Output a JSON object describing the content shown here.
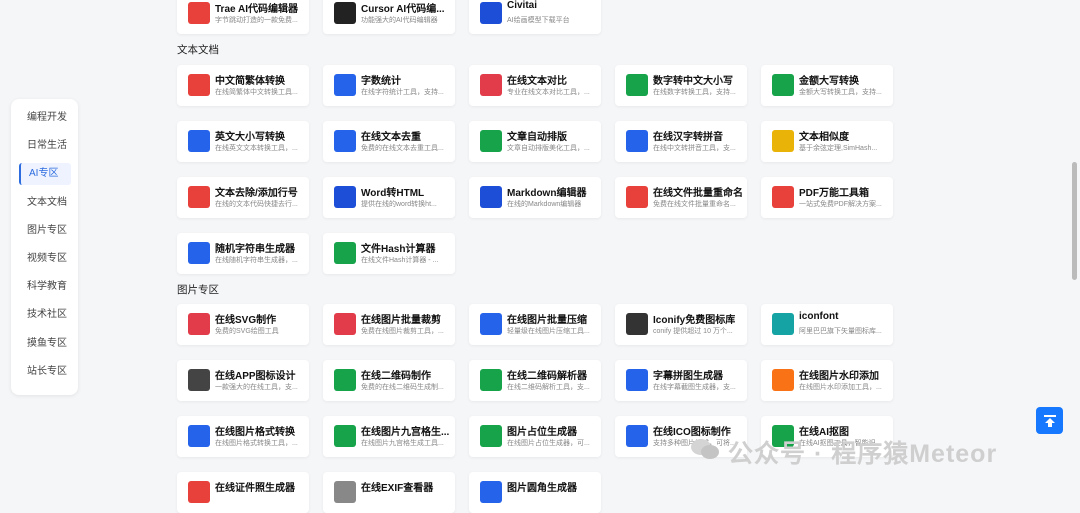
{
  "sidebar": {
    "items": [
      {
        "label": "编程开发",
        "active": false
      },
      {
        "label": "日常生活",
        "active": false
      },
      {
        "label": "AI专区",
        "active": true
      },
      {
        "label": "文本文档",
        "active": false
      },
      {
        "label": "图片专区",
        "active": false
      },
      {
        "label": "视频专区",
        "active": false
      },
      {
        "label": "科学教育",
        "active": false
      },
      {
        "label": "技术社区",
        "active": false
      },
      {
        "label": "摸鱼专区",
        "active": false
      },
      {
        "label": "站长专区",
        "active": false
      }
    ]
  },
  "ai_tools": [
    {
      "title": "Trae AI代码编辑器",
      "desc": "字节跳动打造的一款免费...",
      "icon": "trae-icon",
      "color": "#e8413c"
    },
    {
      "title": "Cursor AI代码编...",
      "desc": "功能强大的AI代码编辑器",
      "icon": "cursor-icon",
      "color": "#222222"
    },
    {
      "title": "Civitai",
      "desc": "AI绘画模型下载平台",
      "icon": "civitai-icon",
      "color": "#1d4ed8"
    }
  ],
  "text_section": {
    "title": "文本文档",
    "tools": [
      {
        "title": "中文简繁体转换",
        "desc": "在线简繁体中文转换工具...",
        "icon": "convert-icon",
        "color": "#e8413c"
      },
      {
        "title": "字数统计",
        "desc": "在线字符统计工具，支持...",
        "icon": "text-count-icon",
        "color": "#2563eb"
      },
      {
        "title": "在线文本对比",
        "desc": "专业在线文本对比工具，...",
        "icon": "compare-icon",
        "color": "#e23b4a"
      },
      {
        "title": "数字转中文大小写",
        "desc": "在线数字转换工具，支持...",
        "icon": "number-icon",
        "color": "#16a34a"
      },
      {
        "title": "金额大写转换",
        "desc": "金额大写转换工具，支持...",
        "icon": "money-icon",
        "color": "#16a34a"
      },
      {
        "title": "英文大小写转换",
        "desc": "在线英文文本转换工具，...",
        "icon": "case-icon",
        "color": "#2563eb"
      },
      {
        "title": "在线文本去重",
        "desc": "免费的在线文本去重工具...",
        "icon": "dedupe-icon",
        "color": "#2563eb"
      },
      {
        "title": "文章自动排版",
        "desc": "文章自动排版美化工具，...",
        "icon": "format-icon",
        "color": "#16a34a"
      },
      {
        "title": "在线汉字转拼音",
        "desc": "在线中文转拼音工具，支...",
        "icon": "pinyin-icon",
        "color": "#2563eb"
      },
      {
        "title": "文本相似度",
        "desc": "基于余弦定理,SimHash...",
        "icon": "similarity-icon",
        "color": "#eab308"
      },
      {
        "title": "文本去除/添加行号",
        "desc": "在线的文本代码快捷去行...",
        "icon": "line-number-icon",
        "color": "#e8413c"
      },
      {
        "title": "Word转HTML",
        "desc": "提供在线的word转换ht...",
        "icon": "word-icon",
        "color": "#1d4ed8"
      },
      {
        "title": "Markdown编辑器",
        "desc": "在线的Markdown编辑器",
        "icon": "markdown-icon",
        "color": "#1d4ed8"
      },
      {
        "title": "在线文件批量重命名",
        "desc": "免费在线文件批量重命名...",
        "icon": "rename-icon",
        "color": "#e8413c"
      },
      {
        "title": "PDF万能工具箱",
        "desc": "一站式免费PDF解决方案...",
        "icon": "pdf-icon",
        "color": "#e8413c"
      },
      {
        "title": "随机字符串生成器",
        "desc": "在线随机字符串生成器，...",
        "icon": "random-string-icon",
        "color": "#2563eb"
      },
      {
        "title": "文件Hash计算器",
        "desc": "在线文件Hash计算器 - ...",
        "icon": "hash-icon",
        "color": "#16a34a"
      }
    ]
  },
  "image_section": {
    "title": "图片专区",
    "tools": [
      {
        "title": "在线SVG制作",
        "desc": "免费的SVG绘图工具",
        "icon": "svg-icon",
        "color": "#e23b4a"
      },
      {
        "title": "在线图片批量裁剪",
        "desc": "免费在线图片裁剪工具，...",
        "icon": "crop-icon",
        "color": "#e23b4a"
      },
      {
        "title": "在线图片批量压缩",
        "desc": "轻量级在线图片压缩工具...",
        "icon": "compress-icon",
        "color": "#2563eb"
      },
      {
        "title": "Iconify免费图标库",
        "desc": "conify 提供超过 10 万个...",
        "icon": "iconify-icon",
        "color": "#333333"
      },
      {
        "title": "iconfont",
        "desc": "阿里巴巴旗下矢量图标库...",
        "icon": "iconfont-icon",
        "color": "#16a3a3"
      },
      {
        "title": "在线APP图标设计",
        "desc": "一款强大的在线工具，支...",
        "icon": "app-icon-design-icon",
        "color": "#444444"
      },
      {
        "title": "在线二维码制作",
        "desc": "免费的在线二维码生成制...",
        "icon": "qrcode-icon",
        "color": "#16a34a"
      },
      {
        "title": "在线二维码解析器",
        "desc": "在线二维码解析工具，支...",
        "icon": "qr-scan-icon",
        "color": "#16a34a"
      },
      {
        "title": "字幕拼图生成器",
        "desc": "在线字幕截图生成器，支...",
        "icon": "subtitle-icon",
        "color": "#2563eb"
      },
      {
        "title": "在线图片水印添加",
        "desc": "在线图片水印添加工具，...",
        "icon": "watermark-icon",
        "color": "#f97316"
      },
      {
        "title": "在线图片格式转换",
        "desc": "在线图片格式转换工具，...",
        "icon": "image-convert-icon",
        "color": "#2563eb"
      },
      {
        "title": "在线图片九宫格生...",
        "desc": "在线图片九宫格生成工具...",
        "icon": "grid-icon",
        "color": "#16a34a"
      },
      {
        "title": "图片占位生成器",
        "desc": "在线图片占位生成器，可...",
        "icon": "placeholder-icon",
        "color": "#16a34a"
      },
      {
        "title": "在线ICO图标制作",
        "desc": "支持多种图片格式，可将...",
        "icon": "ico-icon",
        "color": "#2563eb"
      },
      {
        "title": "在线AI抠图",
        "desc": "在线AI抠图工具，智能识...",
        "icon": "ai-cutout-icon",
        "color": "#16a34a"
      },
      {
        "title": "在线证件照生成器",
        "desc": "",
        "icon": "id-photo-icon",
        "color": "#e8413c"
      },
      {
        "title": "在线EXIF查看器",
        "desc": "",
        "icon": "exif-icon",
        "color": "#888888"
      },
      {
        "title": "图片圆角生成器",
        "desc": "",
        "icon": "round-corner-icon",
        "color": "#2563eb"
      }
    ]
  },
  "watermark": {
    "text": "公众号 · 程序猿Meteor"
  }
}
